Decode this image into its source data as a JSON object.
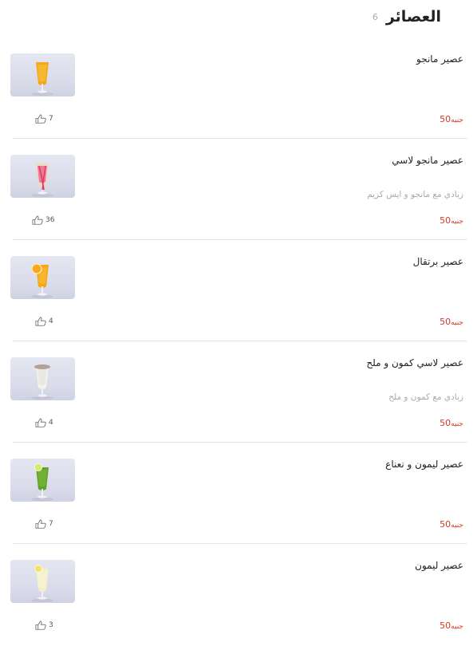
{
  "header": {
    "title": "العصائر",
    "count": "6"
  },
  "currency": "جنيه",
  "items": [
    {
      "name": "عصير مانجو",
      "desc": "",
      "price": "50",
      "likes": "7",
      "glass": "#f3a81c",
      "liquid2": "#f7c43a",
      "style": "mango"
    },
    {
      "name": "عصير مانجو لاسي",
      "desc": "زبادي مع مانجو و ايس كريم",
      "price": "50",
      "likes": "36",
      "glass": "#f0d9c4",
      "liquid2": "#e6356b",
      "style": "lassi"
    },
    {
      "name": "عصير برتقال",
      "desc": "",
      "price": "50",
      "likes": "4",
      "glass": "#f7a416",
      "liquid2": "#fbc23a",
      "style": "orange"
    },
    {
      "name": "عصير لاسي كمون و ملح",
      "desc": "زبادي مع كمون و ملح",
      "price": "50",
      "likes": "4",
      "glass": "#f4f3ee",
      "liquid2": "#e2dfd6",
      "style": "white"
    },
    {
      "name": "عصير ليمون و نعناع",
      "desc": "",
      "price": "50",
      "likes": "7",
      "glass": "#5fa12a",
      "liquid2": "#7fc03a",
      "style": "mint"
    },
    {
      "name": "عصير ليمون",
      "desc": "",
      "price": "50",
      "likes": "3",
      "glass": "#f3f0c8",
      "liquid2": "#faf6d8",
      "style": "lemon"
    }
  ]
}
